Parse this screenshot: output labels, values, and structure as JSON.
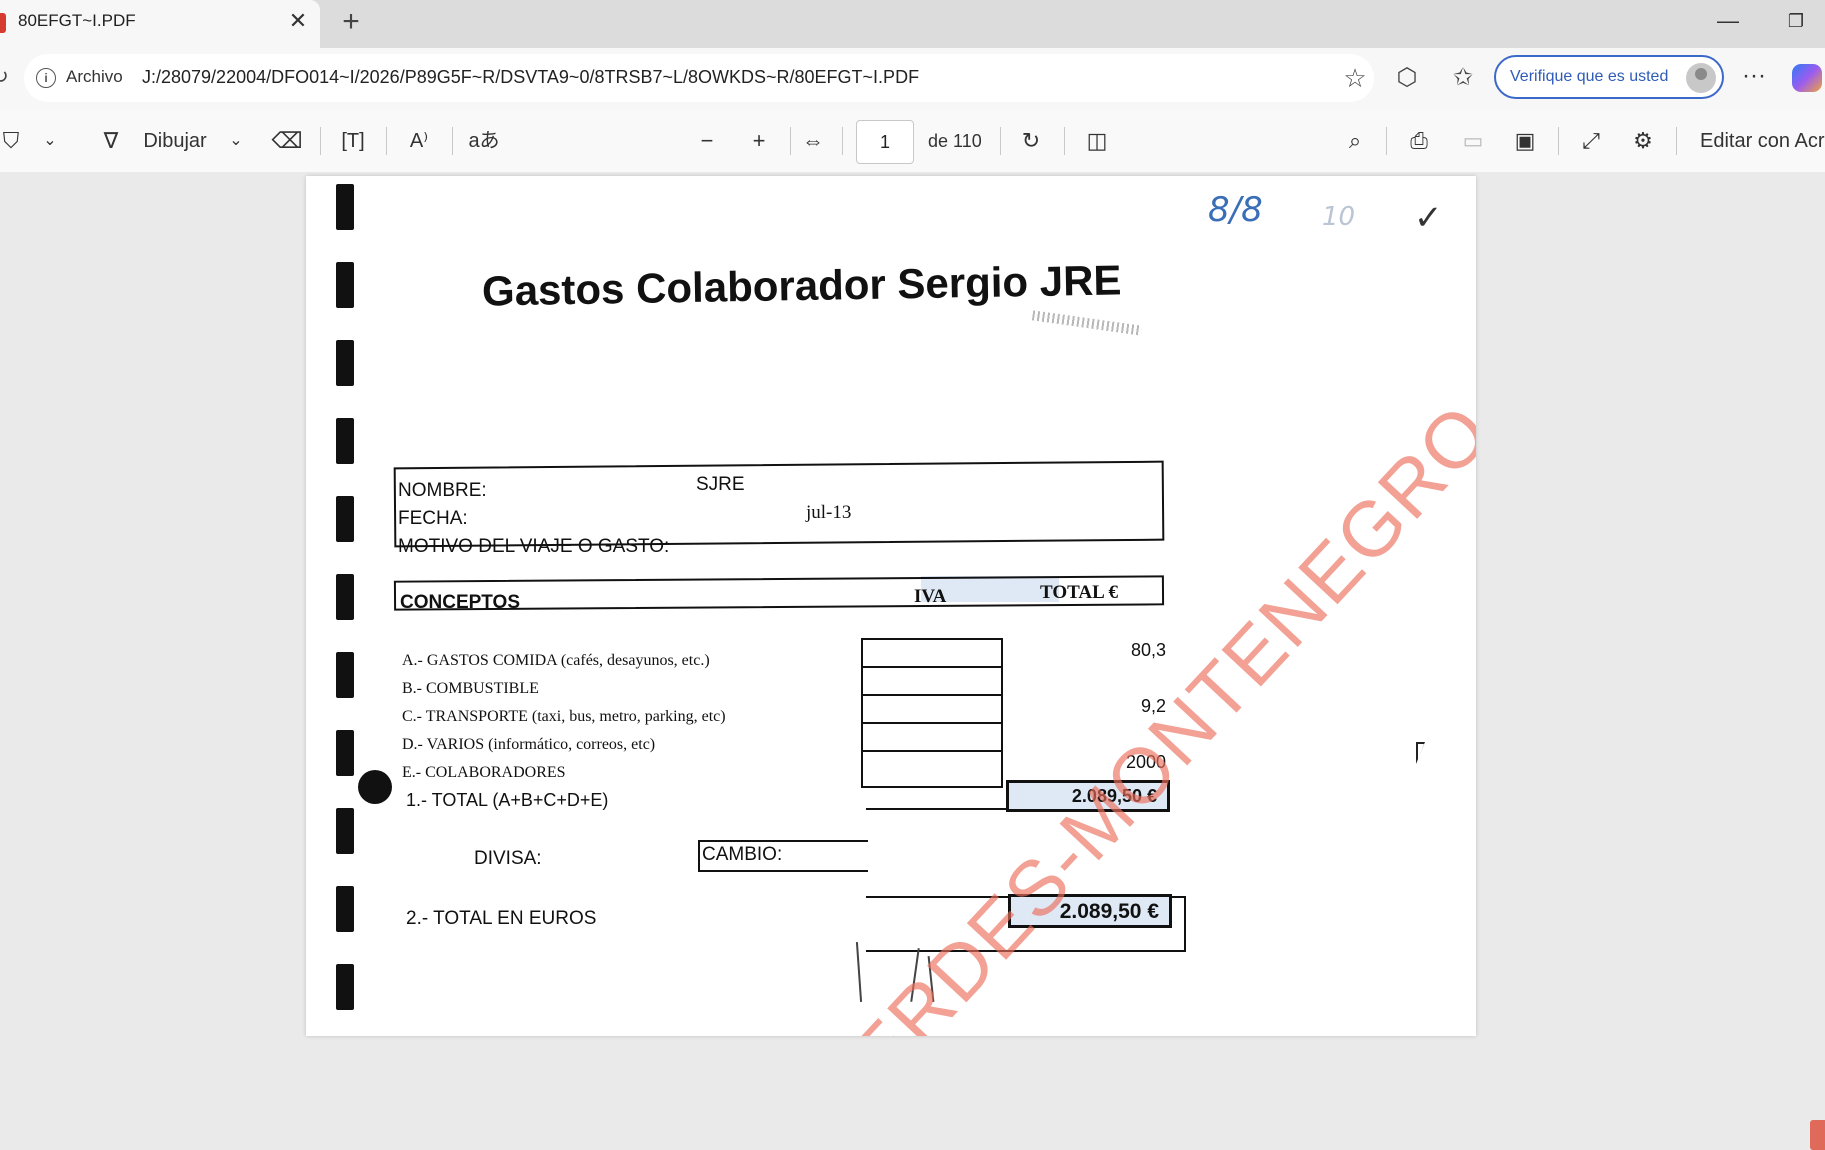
{
  "browser": {
    "tab_title": "80EFGT~I.PDF",
    "tab_close": "✕",
    "new_tab": "+",
    "minimize": "—",
    "restore": "❐",
    "address_label": "Archivo",
    "url": "J:/28079/22004/DFO014~I/2026/P89G5F~R/DSVTA9~0/8TRSB7~L/8OWKDS~R/80EFGT~I.PDF",
    "verify_label": "Verifique que es usted",
    "more": "···"
  },
  "pdf_toolbar": {
    "draw_label": "Dibujar",
    "page_current": "1",
    "page_total": "de 110",
    "edit_label": "Editar con Acr"
  },
  "document": {
    "handwritten_number": "8/8",
    "handwritten_mark": "10",
    "checkmark": "✓",
    "title": "Gastos Colaborador Sergio JRE",
    "nombre_label": "NOMBRE:",
    "nombre_value": "SJRE",
    "fecha_label": "FECHA:",
    "fecha_value": "jul-13",
    "motivo_label": "MOTIVO DEL VIAJE O GASTO:",
    "conceptos_header": "CONCEPTOS",
    "iva_header": "IVA",
    "total_header": "TOTAL €",
    "concepts": [
      {
        "label": "A.- GASTOS COMIDA (cafés, desayunos, etc.)",
        "total": "80,3"
      },
      {
        "label": "B.- COMBUSTIBLE",
        "total": ""
      },
      {
        "label": "C.- TRANSPORTE (taxi, bus, metro, parking, etc)",
        "total": "9,2"
      },
      {
        "label": "D.- VARIOS (informático, correos, etc)",
        "total": ""
      },
      {
        "label": "E.- COLABORADORES",
        "total": "2000"
      }
    ],
    "total_label": "1.- TOTAL (A+B+C+D+E)",
    "total_value": "2.089,50 €",
    "divisa_label": "DIVISA:",
    "cambio_label": "CAMBIO:",
    "total_euros_label": "2.- TOTAL EN EUROS",
    "total_euros_value": "2.089,50 €",
    "watermark": "VERDES-MONTENEGRO"
  },
  "colors": {
    "watermark": "#eb6e5a",
    "handwriting": "#3a6fb8",
    "verify_border": "#3b68c9",
    "total_fill": "#dfe9f6"
  }
}
